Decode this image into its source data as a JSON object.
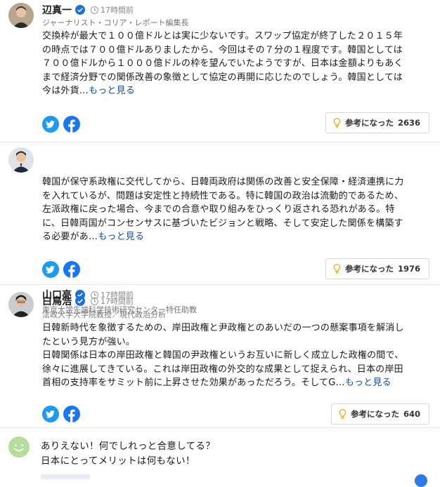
{
  "comments": [
    {
      "name": "辺真一",
      "time": "17時間前",
      "role": "ジャーナリスト・コリア・レポート編集長",
      "lines": [
        "交換枠が最大で１００億ドルとは実に少ないです。スワップ協定が終了した２０１５年",
        "の時点では７００億ドルありましたから、今回はその７分の１程度です。韓国としては",
        "７００億ドルから１０００億ドルの枠を望んでいたようですが、日本は金額よりもあく",
        "まで経済分野での関係改善の象徴として協定の再開に応じたのでしょう。韓国としては",
        "今は外貨…"
      ],
      "more": "もっと見る",
      "helpful_label": "参考になった",
      "helpful_count": "2636"
    },
    {
      "name": "山口亮",
      "time": "17時間前",
      "role": "東京大学先端科学技術研究センター特任助教",
      "lines": [
        "韓国が保守系政権に交代してから、日韓両政府は関係の改善と安全保障・経済連携に力",
        "を入れているが、問題は安定性と持続性である。特に韓国の政治は流動的であるため、",
        "左派政権に戻った場合、今までの合意や取り組みをひっくり返される恐れがある。特",
        "に、日韓両国がコンセンサスに基づいたビジョンと戦略、そして安定した関係を構築す",
        "る必要があ…"
      ],
      "more": "もっと見る",
      "helpful_label": "参考になった",
      "helpful_count": "1976"
    },
    {
      "name": "白鳥浩",
      "time": "17時間前",
      "role": "法政大学大学院教授／現代政治分析",
      "lines": [
        "日韓新時代を象徴するための、岸田政権と尹政権とのあいだの一つの懸案事項を解消し",
        "たという見方が強い。",
        "日韓関係は日本の岸田政権と韓国の尹政権というお互いに新しく成立した政権の間で、",
        "徐々に進展してきている。これは岸田政権の外交的な成果として捉えられ、日本の岸田",
        "首相の支持率をサミット前に上昇させた効果があっただろう。そしてG…"
      ],
      "more": "もっと見る",
      "helpful_label": "参考になった",
      "helpful_count": "640"
    }
  ],
  "user_comment": {
    "lines": [
      "ありえない！何でしれっと合意してる？",
      "日本にとってメリットは何もない！"
    ]
  },
  "colors": {
    "verified": "#1d6fe0",
    "twitter": "#1d9bf0",
    "facebook": "#1877f2",
    "link": "#0b4fa8",
    "bulb": "#f2a900"
  }
}
